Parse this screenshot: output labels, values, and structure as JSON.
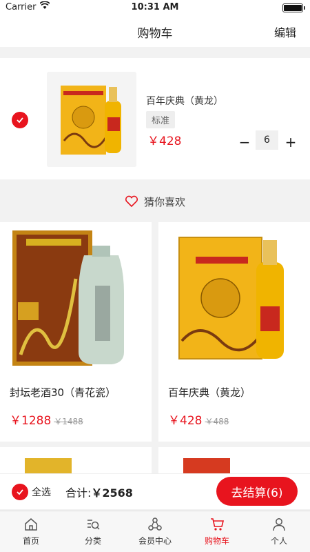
{
  "status": {
    "carrier": "Carrier",
    "time": "10:31 AM",
    "battery_level": 1.0
  },
  "nav": {
    "title": "购物车",
    "edit_label": "编辑"
  },
  "cart_item": {
    "name": "百年庆典（黄龙）",
    "spec": "标准",
    "price": "￥428",
    "minus_label": "−",
    "quantity": "6",
    "plus_label": "+",
    "checked": true
  },
  "guess": {
    "title": "猜你喜欢"
  },
  "recommendations": [
    {
      "name": "封坛老酒30（青花瓷）",
      "price": "￥1288",
      "original": "￥1488"
    },
    {
      "name": "百年庆典（黄龙）",
      "price": "￥428",
      "original": "￥488"
    }
  ],
  "bottom": {
    "select_all": "全选",
    "total_label": "合计:",
    "total_value": "￥2568",
    "checkout_label": "去结算(6)"
  },
  "tabs": [
    {
      "label": "首页",
      "icon": "home-icon"
    },
    {
      "label": "分类",
      "icon": "category-icon"
    },
    {
      "label": "会员中心",
      "icon": "member-icon"
    },
    {
      "label": "购物车",
      "icon": "cart-icon",
      "active": true
    },
    {
      "label": "个人",
      "icon": "person-icon"
    }
  ],
  "colors": {
    "accent": "#e8141e",
    "gold": "#f2b418"
  }
}
